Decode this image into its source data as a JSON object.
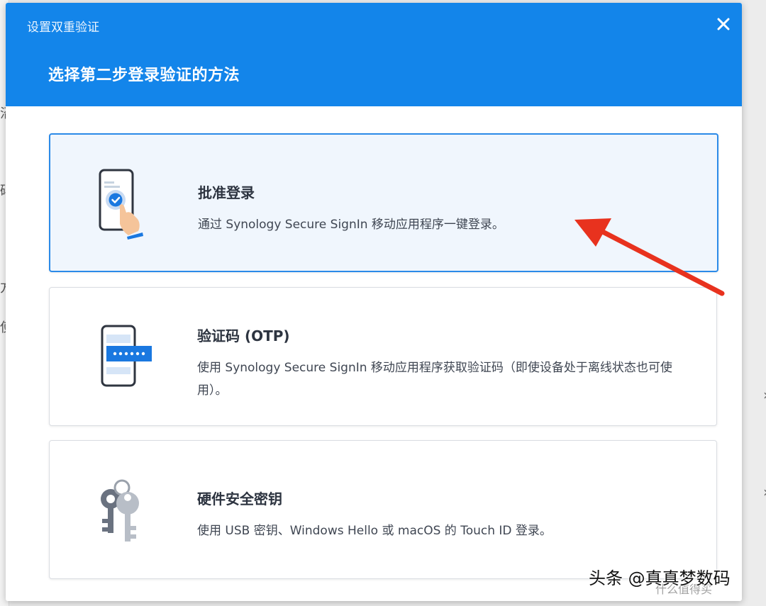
{
  "background": {
    "left_fragments": [
      "沼",
      "码",
      "方",
      "使"
    ]
  },
  "dialog": {
    "window_title": "设置双重验证",
    "close_icon": "close-icon",
    "page_title": "选择第二步登录验证的方法",
    "header_color": "#1385ea",
    "options": [
      {
        "id": "approve",
        "icon": "phone-approve-icon",
        "title": "批准登录",
        "description": "通过 Synology Secure SignIn 移动应用程序一键登录。",
        "selected": true
      },
      {
        "id": "otp",
        "icon": "phone-otp-icon",
        "title": "验证码 (OTP)",
        "description": "使用 Synology Secure SignIn 移动应用程序获取验证码（即使设备处于离线状态也可使用）。",
        "selected": false
      },
      {
        "id": "hardware-key",
        "icon": "keys-icon",
        "title": "硬件安全密钥",
        "description": "使用 USB 密钥、Windows Hello 或 macOS 的 Touch ID 登录。",
        "selected": false
      }
    ]
  },
  "annotation": {
    "arrow_color": "#e8321e"
  },
  "watermark": {
    "text": "头条 @真真梦数码",
    "secondary": "什么值得买"
  }
}
